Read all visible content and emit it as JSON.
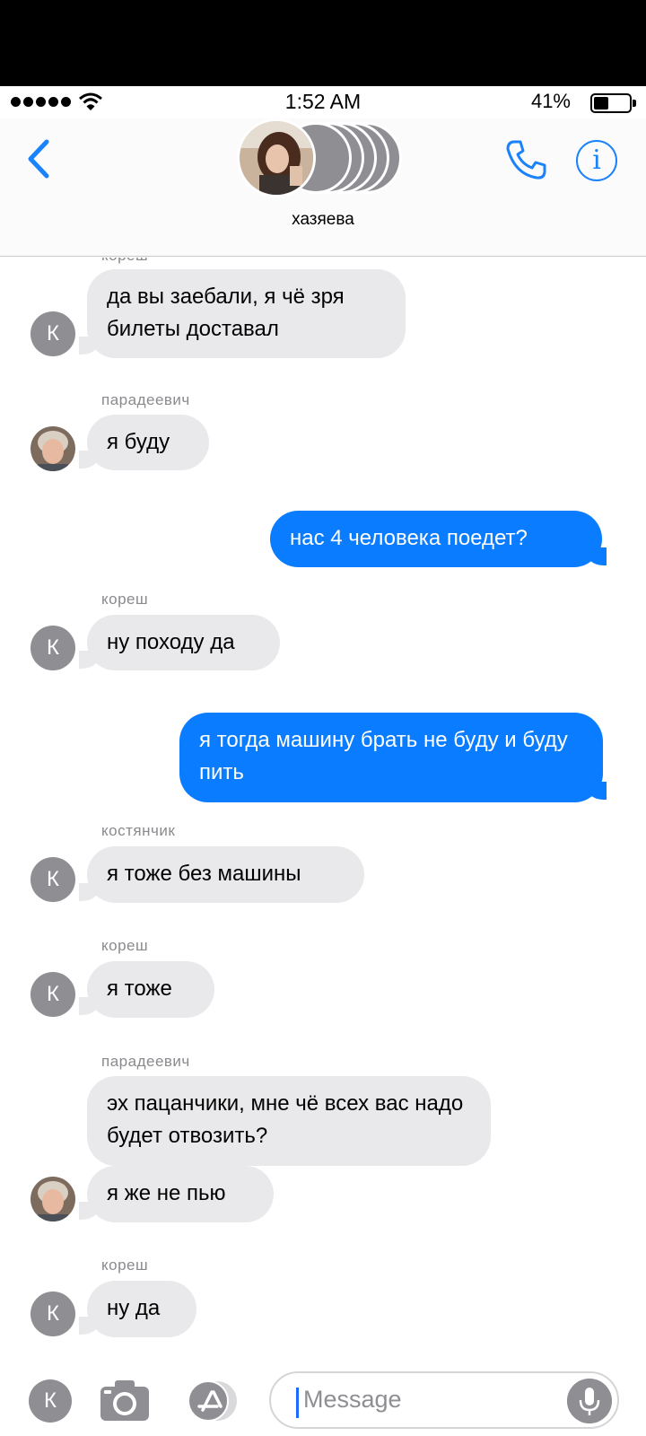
{
  "status_bar": {
    "time": "1:52 AM",
    "battery_percent": "41%",
    "battery_level": 0.41
  },
  "header": {
    "group_name": "хазяева"
  },
  "thread": {
    "messages": [
      {
        "sender": "кореш",
        "text": "да вы заебали, я чё зря билеты доставал",
        "direction": "incoming",
        "avatar": "К"
      },
      {
        "sender": "парадеевич",
        "text": "я буду",
        "direction": "incoming",
        "avatar": "photo"
      },
      {
        "text": "нас 4 человека поедет?",
        "direction": "outgoing"
      },
      {
        "sender": "кореш",
        "text": "ну походу да",
        "direction": "incoming",
        "avatar": "К"
      },
      {
        "text": "я тогда машину брать не буду и буду пить",
        "direction": "outgoing"
      },
      {
        "sender": "костянчик",
        "text": "я тоже без машины",
        "direction": "incoming",
        "avatar": "К"
      },
      {
        "sender": "кореш",
        "text": "я тоже",
        "direction": "incoming",
        "avatar": "К"
      },
      {
        "sender": "парадеевич",
        "text": "эх пацанчики, мне чё всех вас надо будет отвозить?",
        "direction": "incoming"
      },
      {
        "text": "я же не пью",
        "direction": "incoming",
        "avatar": "photo"
      },
      {
        "sender": "кореш",
        "text": "ну да",
        "direction": "incoming",
        "avatar": "К"
      }
    ]
  },
  "composer": {
    "avatar_letter": "К",
    "placeholder": "Message"
  },
  "colors": {
    "accent": "#1a82fb",
    "outgoing_bubble": "#0a7cff",
    "incoming_bubble": "#e9e9eb",
    "avatar_gray": "#8e8e93"
  }
}
